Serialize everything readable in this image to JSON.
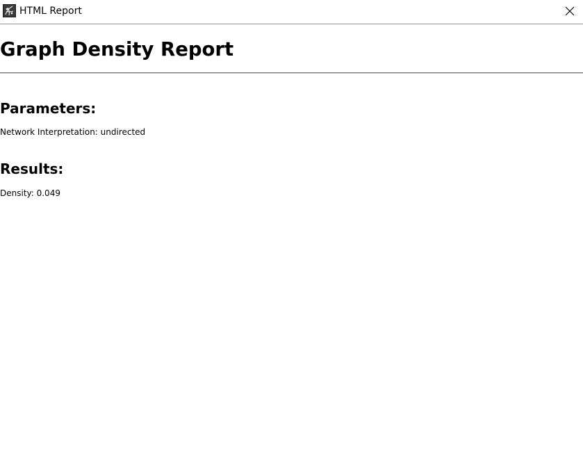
{
  "window": {
    "title": "HTML Report",
    "icon": "app-logo-icon",
    "close_icon": "close-icon"
  },
  "report": {
    "title": "Graph Density Report",
    "parameters": {
      "heading": "Parameters:",
      "text": "Network Interpretation: undirected"
    },
    "results": {
      "heading": "Results:",
      "text": "Density: 0.049"
    }
  }
}
